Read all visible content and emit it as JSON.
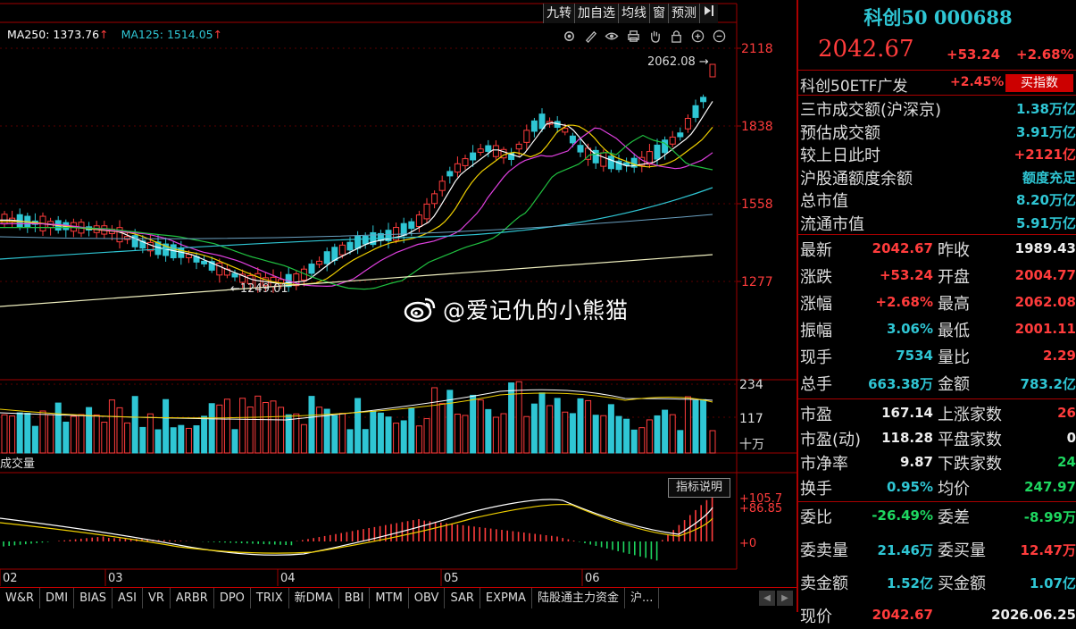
{
  "toolbar": {
    "tabs": [
      "九转",
      "加自选",
      "均线",
      "窗",
      "预测"
    ],
    "collapse_icon": "collapse-right-icon"
  },
  "ma_legend": {
    "ma250_label": "MA250: 1373.76",
    "ma125_label": "MA125: 1514.05",
    "up_arrow": "↑"
  },
  "tool_icons": [
    "settings-icon",
    "pen-icon",
    "eye-icon",
    "print-icon",
    "hand-icon",
    "lock-icon",
    "zoom-in-icon",
    "zoom-out-icon"
  ],
  "price_axis": [
    "2118",
    "1838",
    "1558",
    "1277"
  ],
  "volume_axis": [
    "234",
    "117",
    "十万"
  ],
  "macd_axis": [
    "+105.7",
    "+86.85",
    "+0"
  ],
  "date_axis": [
    "02",
    "03",
    "04",
    "05",
    "06"
  ],
  "annotations": {
    "high": "2062.08",
    "low": "1249.01"
  },
  "volume_label": "成交量",
  "indicator_button": "指标说明",
  "watermark": "@爱记仇的小熊猫",
  "bottom_tabs": [
    "W&R",
    "DMI",
    "BIAS",
    "ASI",
    "VR",
    "ARBR",
    "DPO",
    "TRIX",
    "新DMA",
    "BBI",
    "MTM",
    "OBV",
    "SAR",
    "EXPMA",
    "陆股通主力资金",
    "沪..."
  ],
  "colors": {
    "up": "#ff3c3c",
    "down": "#2fc6d4",
    "border": "#a00000",
    "accent_cyan": "#2fc6d4",
    "green": "#1ed760"
  },
  "panel": {
    "title": "科创50 000688",
    "price": "2042.67",
    "change": "+53.24",
    "change_pct": "+2.68%",
    "etf": {
      "name": "科创50ETF广发",
      "pct": "+2.45%",
      "button": "买指数"
    },
    "market_rows": [
      {
        "label": "三市成交额(沪深京)",
        "value": "1.38万亿",
        "color": "cyan"
      },
      {
        "label": "预估成交额",
        "value": "3.91万亿",
        "color": "cyan"
      },
      {
        "label": "较上日此时",
        "value": "+2121亿",
        "color": "red"
      },
      {
        "label": "沪股通额度余额",
        "value": "额度充足",
        "color": "cyan"
      },
      {
        "label": "总市值",
        "value": "8.20万亿",
        "color": "cyan"
      },
      {
        "label": "流通市值",
        "value": "5.91万亿",
        "color": "cyan"
      }
    ],
    "quote_rows": [
      {
        "l1": "最新",
        "v1": "2042.67",
        "c1": "red",
        "l2": "昨收",
        "v2": "1989.43",
        "c2": "white"
      },
      {
        "l1": "涨跌",
        "v1": "+53.24",
        "c1": "red",
        "l2": "开盘",
        "v2": "2004.77",
        "c2": "red"
      },
      {
        "l1": "涨幅",
        "v1": "+2.68%",
        "c1": "red",
        "l2": "最高",
        "v2": "2062.08",
        "c2": "red"
      },
      {
        "l1": "振幅",
        "v1": "3.06%",
        "c1": "cyan",
        "l2": "最低",
        "v2": "2001.11",
        "c2": "red"
      },
      {
        "l1": "现手",
        "v1": "7534",
        "c1": "cyan",
        "l2": "量比",
        "v2": "2.29",
        "c2": "red"
      },
      {
        "l1": "总手",
        "v1": "663.38万",
        "c1": "cyan",
        "l2": "金额",
        "v2": "783.2亿",
        "c2": "cyan"
      }
    ],
    "fund_rows": [
      {
        "l1": "市盈",
        "v1": "167.14",
        "c1": "white",
        "l2": "上涨家数",
        "v2": "26",
        "c2": "red"
      },
      {
        "l1": "市盈(动)",
        "v1": "118.28",
        "c1": "white",
        "l2": "平盘家数",
        "v2": "0",
        "c2": "white"
      },
      {
        "l1": "市净率",
        "v1": "9.87",
        "c1": "white",
        "l2": "下跌家数",
        "v2": "24",
        "c2": "green"
      },
      {
        "l1": "换手",
        "v1": "0.95%",
        "c1": "cyan",
        "l2": "均价",
        "v2": "247.97",
        "c2": "green"
      }
    ],
    "order_rows": [
      {
        "l1": "委比",
        "v1": "-26.49%",
        "c1": "green",
        "l2": "委差",
        "v2": "-8.99万",
        "c2": "green"
      },
      {
        "l1": "委卖量",
        "v1": "21.46万",
        "c1": "cyan",
        "l2": "委买量",
        "v2": "12.47万",
        "c2": "red"
      },
      {
        "l1": "卖金额",
        "v1": "1.52亿",
        "c1": "cyan",
        "l2": "买金额",
        "v2": "1.07亿",
        "c2": "cyan"
      },
      {
        "l1": "现价",
        "v1": "2042.67",
        "c1": "red",
        "l2": "",
        "v2": "2026.06.25",
        "c2": "white"
      }
    ]
  }
}
